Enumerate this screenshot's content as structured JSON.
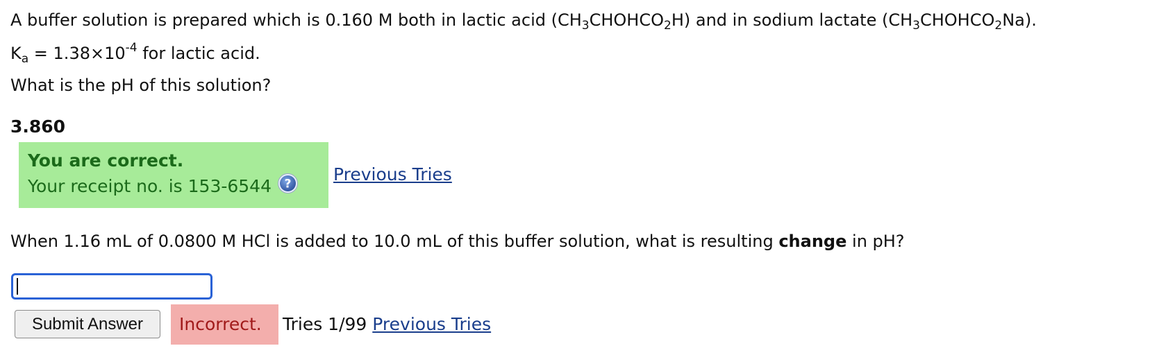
{
  "question1": {
    "intro": "A buffer solution is prepared which is 0.160 M both in lactic acid (",
    "acid_formula_a": "CH",
    "acid_formula_sub1": "3",
    "acid_formula_b": "CHOHCO",
    "acid_formula_sub2": "2",
    "acid_formula_c": "H",
    "middle": ") and in sodium lactate (",
    "salt_formula_a": "CH",
    "salt_formula_sub1": "3",
    "salt_formula_b": "CHOHCO",
    "salt_formula_sub2": "2",
    "salt_formula_c": "Na",
    "end": ").",
    "ka_symbol": "K",
    "ka_sub": "a",
    "ka_value": " = 1.38×10",
    "ka_exponent": "-4",
    "ka_tail": " for lactic acid.",
    "prompt": "What is the pH of this solution?",
    "answer": "3.860",
    "feedback": {
      "title": "You are correct.",
      "receipt": "Your receipt no. is 153-6544",
      "help_icon": "question-mark-icon",
      "color": "#1b6a1a",
      "background": "#a7eb99"
    },
    "previous_tries_link": "Previous Tries"
  },
  "question2": {
    "prompt_a": "When 1.16 mL of 0.0800 M HCl is added to 10.0 mL of this buffer solution, what is resulting ",
    "prompt_bold": "change",
    "prompt_b": " in pH?",
    "input_value": "",
    "submit_label": "Submit Answer",
    "status": "Incorrect.",
    "status_color": "#a11a1a",
    "status_background": "#f3aeac",
    "tries": "Tries 1/99",
    "previous_tries_link": "Previous Tries"
  },
  "colors": {
    "link": "#1a3e8c",
    "input_focus_border": "#2a62d6"
  }
}
